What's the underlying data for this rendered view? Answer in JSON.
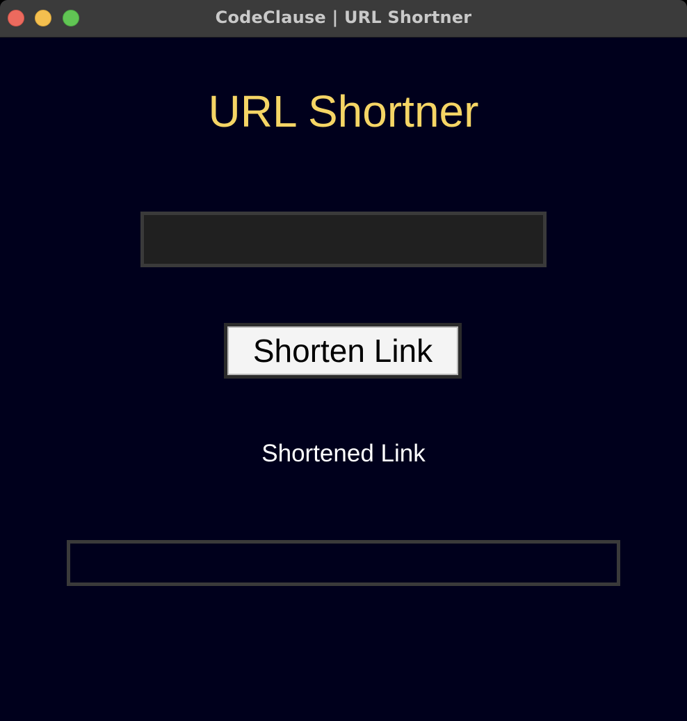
{
  "window": {
    "title": "CodeClause | URL Shortner"
  },
  "app": {
    "heading": "URL Shortner",
    "url_input": {
      "value": "",
      "placeholder": ""
    },
    "shorten_button_label": "Shorten Link",
    "result_label": "Shortened Link",
    "result_value": ""
  },
  "colors": {
    "background": "#00001c",
    "heading": "#f5d565",
    "input_background": "#202020",
    "border": "#3a3a3a",
    "button_background": "#f4f4f4",
    "label_text": "#ffffff"
  },
  "icons": {
    "close": "close-traffic-light-icon",
    "minimize": "minimize-traffic-light-icon",
    "zoom": "zoom-traffic-light-icon"
  }
}
